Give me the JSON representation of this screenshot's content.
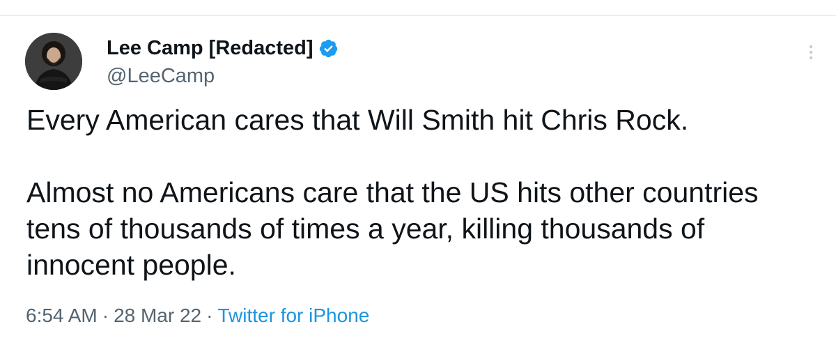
{
  "tweet": {
    "author": {
      "display_name": "Lee Camp [Redacted]",
      "handle": "@LeeCamp",
      "verified": true,
      "avatar": "profile-photo"
    },
    "text": "Every American cares that Will Smith hit Chris Rock.\n\nAlmost no Americans care that the US hits other countries tens of thousands of times a year, killing thousands of innocent people.",
    "meta": {
      "time": "6:54 AM",
      "separator": "·",
      "date": "28 Mar 22",
      "source": "Twitter for iPhone"
    },
    "icons": {
      "verified": "verified-badge-icon",
      "more": "more-options-icon"
    },
    "colors": {
      "text": "#0f1419",
      "secondary_text": "#536471",
      "link": "#1b95e0",
      "verified_badge": "#1d9bf0",
      "divider": "#e1e8ed"
    }
  }
}
